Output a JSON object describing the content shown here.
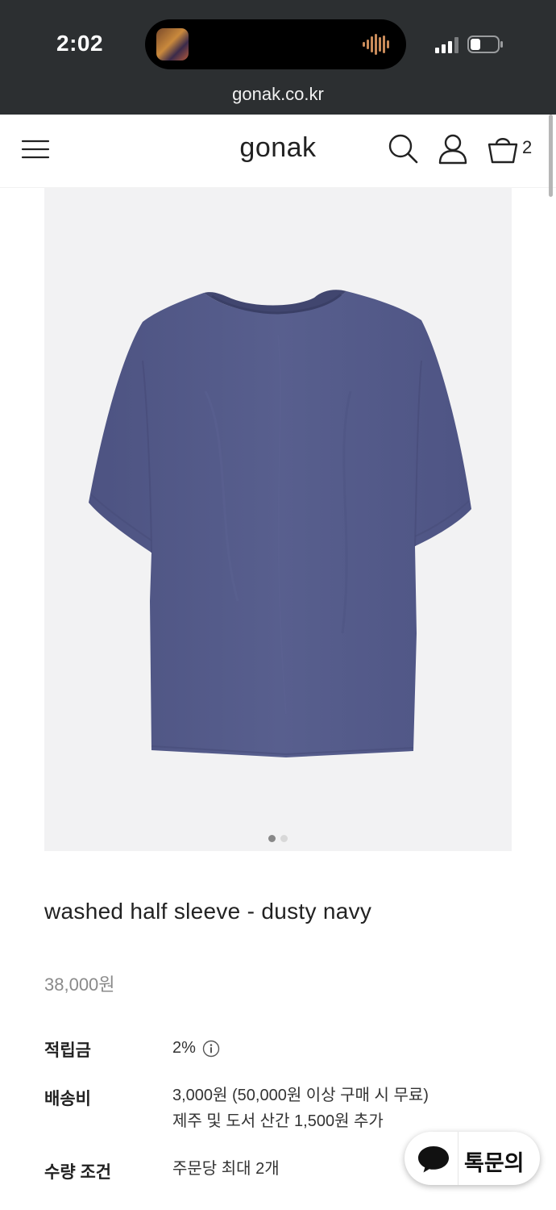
{
  "status_bar": {
    "time": "2:02",
    "url": "gonak.co.kr"
  },
  "header": {
    "logo": "gonak",
    "cart_count": "2"
  },
  "product": {
    "title": "washed half sleeve - dusty navy",
    "price": "38,000원",
    "shirt_color": "#545b8a",
    "image_count": 2,
    "active_image": 1
  },
  "details": [
    {
      "label": "적립금",
      "value": "2%"
    },
    {
      "label": "배송비",
      "value": "3,000원 (50,000원 이상 구매 시 무료)",
      "value2": "제주 및 도서 산간 1,500원 추가"
    },
    {
      "label": "수량 조건",
      "value": "주문당 최대 2개"
    }
  ],
  "chat": {
    "label": "톡문의"
  }
}
